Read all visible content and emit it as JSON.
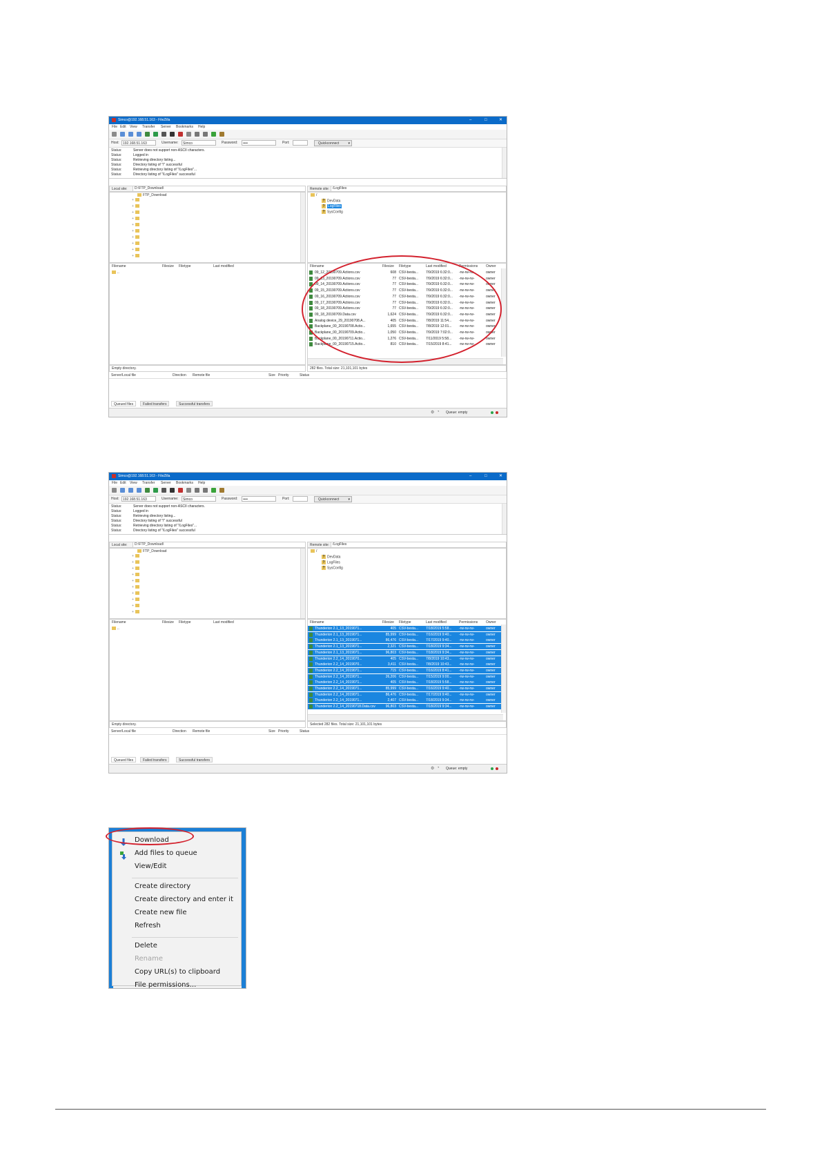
{
  "shots": [
    {
      "title": "Simco@192.168.51.163 - FileZilla",
      "menu": [
        "File",
        "Edit",
        "View",
        "Transfer",
        "Server",
        "Bookmarks",
        "Help"
      ],
      "quickconnect": {
        "host_label": "Host:",
        "host_value": "192.168.51.163",
        "user_label": "Username:",
        "user_value": "Simco",
        "pass_label": "Password:",
        "pass_value": "••••",
        "port_label": "Port:",
        "port_value": "",
        "button_label": "Quickconnect"
      },
      "log": [
        {
          "level": "Status:",
          "text": "Server does not support non-ASCII characters."
        },
        {
          "level": "Status:",
          "text": "Logged in"
        },
        {
          "level": "Status:",
          "text": "Retrieving directory listing..."
        },
        {
          "level": "Status:",
          "text": "Directory listing of \"/\" successful"
        },
        {
          "level": "Status:",
          "text": "Retrieving directory listing of \"/LogFiles\"..."
        },
        {
          "level": "Status:",
          "text": "Directory listing of \"/LogFiles\" successful"
        }
      ],
      "local_site_label": "Local site:",
      "local_site_path": "D:\\FTP_Download\\",
      "local_tree_root": "FTP_Download",
      "remote_site_label": "Remote site:",
      "remote_site_path": "/LogFiles",
      "remote_tree": [
        "/",
        "DevData",
        "LogFiles",
        "SysConfig"
      ],
      "local_headers": [
        "Filename",
        "Filesize",
        "Filetype",
        "Last modified"
      ],
      "local_rows": [
        ".."
      ],
      "remote_headers": [
        "Filename",
        "Filesize",
        "Filetype",
        "Last modified",
        "Permissions",
        "Owner"
      ],
      "remote_rows": [
        [
          "09_12_20190709.Actions.csv",
          "608",
          "CSV-bestа...",
          "7/9/2019 6:32:0...",
          "-rw-rw-rw-",
          "owner"
        ],
        [
          "09_13_20190709.Actions.csv",
          "77",
          "CSV-bestа...",
          "7/9/2019 6:32:0...",
          "-rw-rw-rw-",
          "owner"
        ],
        [
          "09_14_20190709.Actions.csv",
          "77",
          "CSV-bestа...",
          "7/9/2019 6:32:0...",
          "-rw-rw-rw-",
          "owner"
        ],
        [
          "09_15_20190709.Actions.csv",
          "77",
          "CSV-bestа...",
          "7/9/2019 6:32:0...",
          "-rw-rw-rw-",
          "owner"
        ],
        [
          "09_16_20190709.Actions.csv",
          "77",
          "CSV-bestа...",
          "7/9/2019 6:32:0...",
          "-rw-rw-rw-",
          "owner"
        ],
        [
          "09_17_20190709.Actions.csv",
          "77",
          "CSV-bestа...",
          "7/9/2019 6:32:0...",
          "-rw-rw-rw-",
          "owner"
        ],
        [
          "09_18_20190709.Actions.csv",
          "77",
          "CSV-bestа...",
          "7/9/2019 6:32:0...",
          "-rw-rw-rw-",
          "owner"
        ],
        [
          "09_18_20190709.Data.csv",
          "1,624",
          "CSV-bestа...",
          "7/9/2019 6:32:0...",
          "-rw-rw-rw-",
          "owner"
        ],
        [
          "Analog device_29_20190708.A...",
          "405",
          "CSV-bestа...",
          "7/8/2019 11:54...",
          "-rw-rw-rw-",
          "owner"
        ],
        [
          "Backplane_00_20190708.Actio...",
          "1,655",
          "CSV-bestа...",
          "7/8/2019 12:01...",
          "-rw-rw-rw-",
          "owner"
        ],
        [
          "Backplane_00_20190709.Actio...",
          "1,050",
          "CSV-bestа...",
          "7/9/2019 7:02:0...",
          "-rw-rw-rw-",
          "owner"
        ],
        [
          "Backplane_00_20190711.Actio...",
          "1,276",
          "CSV-bestа...",
          "7/11/2019 5:58...",
          "-rw-rw-rw-",
          "owner"
        ],
        [
          "Backplane_00_20190715.Actio...",
          "810",
          "CSV-bestа...",
          "7/15/2019 8:41...",
          "-rw-rw-rw-",
          "owner"
        ]
      ],
      "local_status": "Empty directory.",
      "remote_status": "282 files. Total size: 21,101,101 bytes",
      "queue_headers": [
        "Server/Local file",
        "Direction",
        "Remote file",
        "Size",
        "Priority",
        "Status"
      ],
      "tabs": [
        "Queued files",
        "Failed transfers",
        "Successful transfers"
      ],
      "queue_status": "Queue: empty"
    },
    {
      "title": "Simco@192.168.51.163 - FileZilla",
      "menu": [
        "File",
        "Edit",
        "View",
        "Transfer",
        "Server",
        "Bookmarks",
        "Help"
      ],
      "quickconnect": {
        "host_label": "Host:",
        "host_value": "192.168.51.163",
        "user_label": "Username:",
        "user_value": "Simco",
        "pass_label": "Password:",
        "pass_value": "••••",
        "port_label": "Port:",
        "port_value": "",
        "button_label": "Quickconnect"
      },
      "log": [
        {
          "level": "Status:",
          "text": "Server does not support non-ASCII characters."
        },
        {
          "level": "Status:",
          "text": "Logged in"
        },
        {
          "level": "Status:",
          "text": "Retrieving directory listing..."
        },
        {
          "level": "Status:",
          "text": "Directory listing of \"/\" successful"
        },
        {
          "level": "Status:",
          "text": "Retrieving directory listing of \"/LogFiles\"..."
        },
        {
          "level": "Status:",
          "text": "Directory listing of \"/LogFiles\" successful"
        }
      ],
      "local_site_label": "Local site:",
      "local_site_path": "D:\\FTP_Download\\",
      "local_tree_root": "FTP_Download",
      "remote_site_label": "Remote site:",
      "remote_site_path": "/LogFiles",
      "remote_tree": [
        "/",
        "DevData",
        "LogFiles",
        "SysConfig"
      ],
      "local_headers": [
        "Filename",
        "Filesize",
        "Filetype",
        "Last modified"
      ],
      "local_rows": [
        ".."
      ],
      "remote_headers": [
        "Filename",
        "Filesize",
        "Filetype",
        "Last modified",
        "Permissions",
        "Owner"
      ],
      "remote_rows": [
        [
          "Thunderion 2.1_13_2019071...",
          "405",
          "CSV-bestа...",
          "7/18/2019 5:58...",
          "-rw-rw-rw-",
          "owner"
        ],
        [
          "Thunderion 2.1_13_2019071...",
          "85,999",
          "CSV-bestа...",
          "7/16/2019 9:40...",
          "-rw-rw-rw-",
          "owner"
        ],
        [
          "Thunderion 2.1_13_2019071...",
          "86,476",
          "CSV-bestа...",
          "7/17/2019 9:40...",
          "-rw-rw-rw-",
          "owner"
        ],
        [
          "Thunderion 2.1_13_2019071...",
          "2,321",
          "CSV-bestа...",
          "7/18/2019 9:34...",
          "-rw-rw-rw-",
          "owner"
        ],
        [
          "Thunderion 2.1_13_2019071...",
          "96,803",
          "CSV-bestа...",
          "7/18/2019 9:34...",
          "-rw-rw-rw-",
          "owner"
        ],
        [
          "Thunderion 2.2_14_2019070...",
          "405",
          "CSV-bestа...",
          "7/8/2019 10:43...",
          "-rw-rw-rw-",
          "owner"
        ],
        [
          "Thunderion 2.2_14_2019070...",
          "3,411",
          "CSV-bestа...",
          "7/8/2019 10:43...",
          "-rw-rw-rw-",
          "owner"
        ],
        [
          "Thunderion 2.2_14_2019071...",
          "715",
          "CSV-bestа...",
          "7/16/2019 8:41...",
          "-rw-rw-rw-",
          "owner"
        ],
        [
          "Thunderion 2.2_14_2019071...",
          "26,206",
          "CSV-bestа...",
          "7/15/2019 9:00...",
          "-rw-rw-rw-",
          "owner"
        ],
        [
          "Thunderion 2.2_14_2019071...",
          "405",
          "CSV-bestа...",
          "7/18/2019 5:58...",
          "-rw-rw-rw-",
          "owner"
        ],
        [
          "Thunderion 2.2_14_2019071...",
          "85,999",
          "CSV-bestа...",
          "7/16/2019 9:40...",
          "-rw-rw-rw-",
          "owner"
        ],
        [
          "Thunderion 2.2_14_2019071...",
          "86,476",
          "CSV-bestа...",
          "7/17/2019 9:40...",
          "-rw-rw-rw-",
          "owner"
        ],
        [
          "Thunderion 2.2_14_2019071...",
          "2,407",
          "CSV-bestа...",
          "7/18/2019 9:34...",
          "-rw-rw-rw-",
          "owner"
        ],
        [
          "Thunderion 2.2_14_20190718.Data.csv",
          "96,803",
          "CSV-bestа...",
          "7/18/2019 9:34...",
          "-rw-rw-rw-",
          "owner"
        ]
      ],
      "local_status": "Empty directory.",
      "remote_status": "Selected 282 files. Total size: 21,101,101 bytes",
      "queue_headers": [
        "Server/Local file",
        "Direction",
        "Remote file",
        "Size",
        "Priority",
        "Status"
      ],
      "tabs": [
        "Queued files",
        "Failed transfers",
        "Successful transfers"
      ],
      "queue_status": "Queue: empty"
    }
  ],
  "context_menu": {
    "items": [
      {
        "label": "Download",
        "icon": "download-arrow-icon",
        "enabled": true
      },
      {
        "label": "Add files to queue",
        "icon": "add-to-queue-icon",
        "enabled": true
      },
      {
        "label": "View/Edit",
        "enabled": true
      },
      {
        "separator": true
      },
      {
        "label": "Create directory",
        "enabled": true
      },
      {
        "label": "Create directory and enter it",
        "enabled": true
      },
      {
        "label": "Create new file",
        "enabled": true
      },
      {
        "label": "Refresh",
        "enabled": true
      },
      {
        "separator": true
      },
      {
        "label": "Delete",
        "enabled": true
      },
      {
        "label": "Rename",
        "enabled": false
      },
      {
        "label": "Copy URL(s) to clipboard",
        "enabled": true
      },
      {
        "label": "File permissions...",
        "enabled": true
      }
    ]
  },
  "colors": {
    "titlebar": "#0b6bc9",
    "selection": "#1a86e0",
    "annotation": "#d3212d",
    "folder": "#e9c45a"
  }
}
